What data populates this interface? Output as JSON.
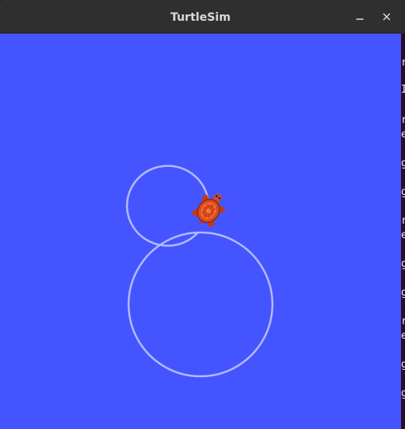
{
  "window": {
    "title": "TurtleSim",
    "background_color": "#4455ff",
    "titlebar_color": "#2f2f2f",
    "controls": {
      "minimize_icon": "minimize-icon",
      "close_icon": "close-icon"
    }
  },
  "canvas": {
    "pen_color": "#b3b8ff",
    "turtle_icon": "turtle-icon",
    "turtle_color": "#e04a1c"
  },
  "background_terminal": {
    "visible_glyphs": [
      "r",
      "I",
      "r",
      "e",
      "g",
      "g",
      "r",
      "e",
      "g",
      "g",
      "r",
      "e",
      "g",
      "g"
    ]
  }
}
